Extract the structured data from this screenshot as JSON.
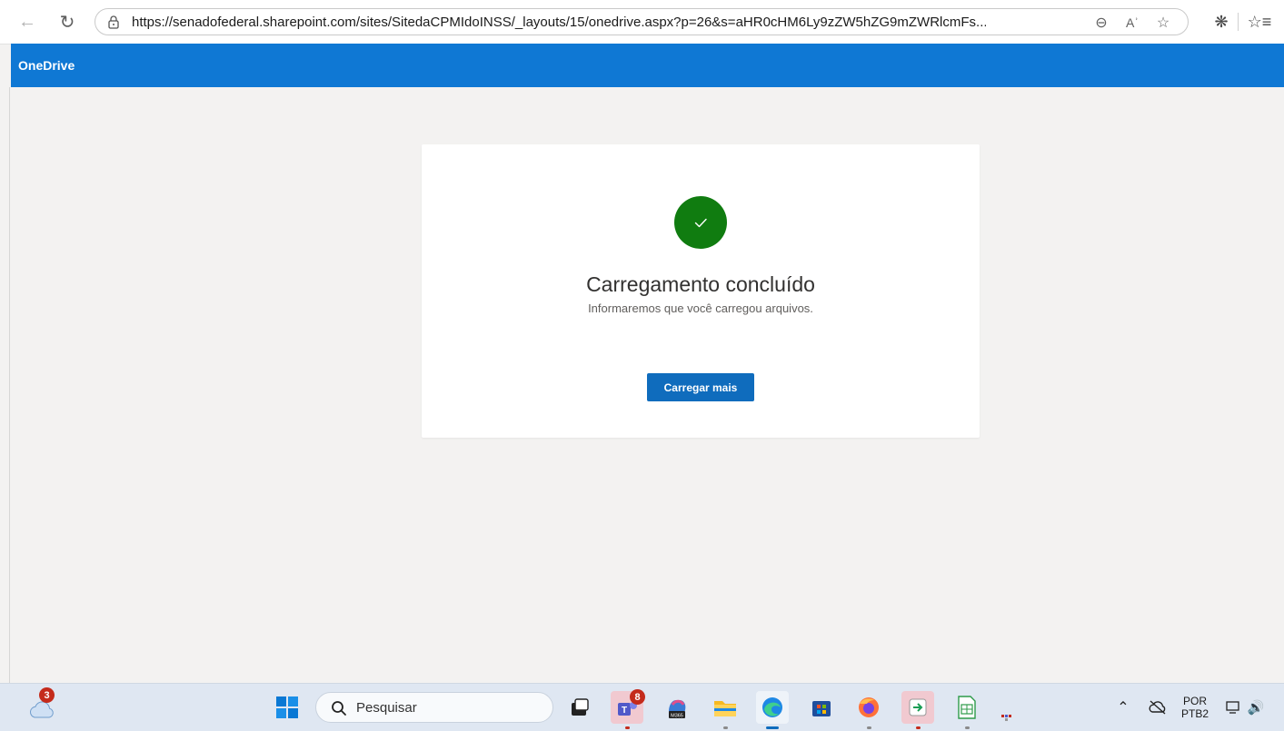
{
  "browser": {
    "url": "https://senadofederal.sharepoint.com/sites/SitedaCPMIdoINSS/_layouts/15/onedrive.aspx?p=26&s=aHR0cHM6Ly9zZW5hZG9mZWRlcmFs..."
  },
  "app": {
    "name": "OneDrive"
  },
  "upload": {
    "title": "Carregamento concluído",
    "subtitle": "Informaremos que você carregou arquivos.",
    "button_label": "Carregar mais"
  },
  "taskbar": {
    "weather_badge": "3",
    "search_placeholder": "Pesquisar",
    "teams_badge": "8",
    "m365_label": "M365",
    "language": "POR",
    "keyboard": "PTB2"
  },
  "colors": {
    "header": "#0f78d4",
    "success": "#107c10",
    "primary": "#0f6cbd"
  }
}
